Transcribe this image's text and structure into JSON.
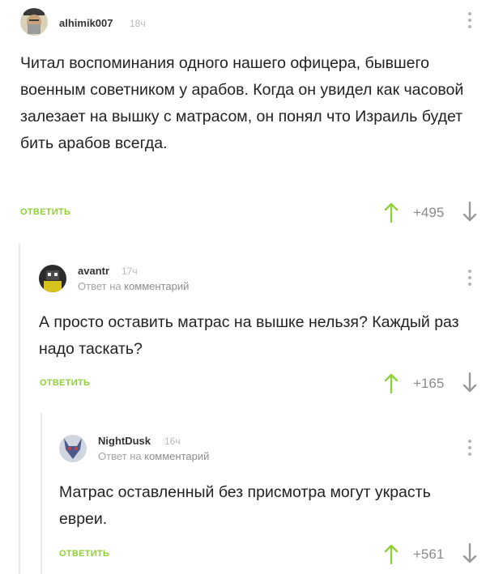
{
  "comments": [
    {
      "username": "alhimik007",
      "time": "18ч",
      "reply_prefix": "",
      "reply_target": "",
      "text": "Читал воспоминания одного нашего офицера, бывшего военным советником у арабов. Когда он увидел как часовой залезает на вышку с матрасом, он понял что Израиль будет бить арабов всегда.",
      "reply_label": "ОТВЕТИТЬ",
      "rating": "+495"
    },
    {
      "username": "avantr",
      "time": "17ч",
      "reply_prefix": "Ответ на",
      "reply_target": "комментарий",
      "text": "А просто оставить матрас на вышке нельзя? Каждый раз надо таскать?",
      "reply_label": "ОТВЕТИТЬ",
      "rating": "+165"
    },
    {
      "username": "NightDusk",
      "time": "16ч",
      "reply_prefix": "Ответ на",
      "reply_target": "комментарий",
      "text": "Матрас оставленный без присмотра могут украсть евреи.",
      "reply_label": "ОТВЕТИТЬ",
      "rating": "+561"
    }
  ],
  "colors": {
    "accent_green": "#8fcf3a",
    "text": "#222222",
    "muted": "#a4a4a4",
    "thread_line": "#e9e9e9"
  },
  "icons": [
    "avatar-alhimik007",
    "avatar-avantr",
    "avatar-nightdusk",
    "more-options-icon",
    "arrow-up-icon",
    "arrow-down-icon"
  ]
}
